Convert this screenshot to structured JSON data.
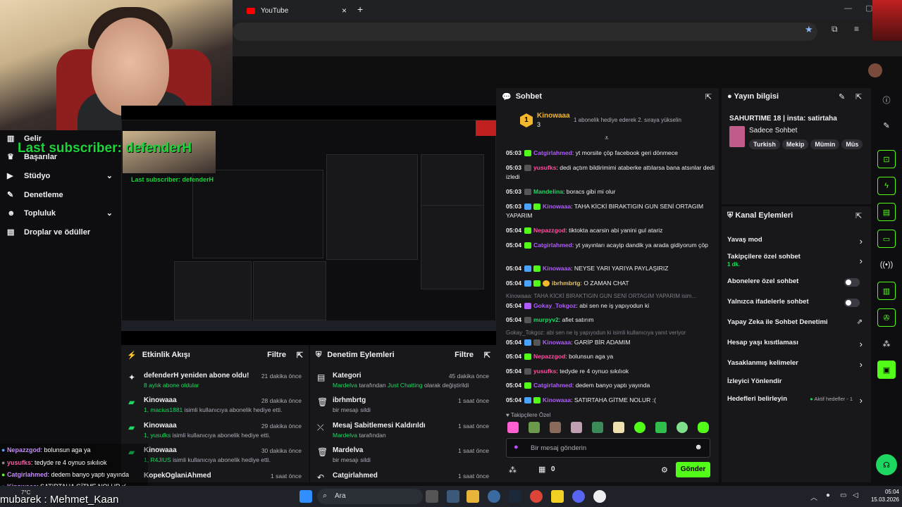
{
  "browser": {
    "tab_title": "YouTube",
    "new_tab": "+",
    "close_tab": "×"
  },
  "overlay": {
    "last_subscriber": "Last subscriber: defenderH",
    "mini_last_subscriber": "Last subscriber: defenderH",
    "mubarek": "mubarek : Mehmet_Kaan"
  },
  "leftnav": {
    "items": [
      {
        "label": "Gelir",
        "icon": "chart-icon"
      },
      {
        "label": "Başarılar",
        "icon": "trophy-icon"
      },
      {
        "label": "Stüdyo",
        "icon": "video-icon"
      },
      {
        "label": "Denetleme",
        "icon": "wrench-icon"
      },
      {
        "label": "Topluluk",
        "icon": "people-icon"
      },
      {
        "label": "Droplar ve ödüller",
        "icon": "gift-icon"
      }
    ]
  },
  "activity": {
    "title": "Etkinlik Akışı",
    "filter": "Filtre",
    "items": [
      {
        "title": "defenderH yeniden abone oldu!",
        "sub_hl": "8 aylık abone oldular",
        "sub": "",
        "time": "21 dakika önce"
      },
      {
        "title": "Kinowaaa",
        "sub_hl": "1, macius1881",
        "sub": " isimli kullanıcıya abonelik hediye etti.",
        "time": "28 dakika önce"
      },
      {
        "title": "Kinowaaa",
        "sub_hl": "1, yusufks",
        "sub": " isimli kullanıcıya abonelik hediye etti.",
        "time": "29 dakika önce"
      },
      {
        "title": "Kinowaaa",
        "sub_hl": "1, R4JIUS",
        "sub": " isimli kullanıcıya abonelik hediye etti.",
        "time": "30 dakika önce"
      },
      {
        "title": "KopekOglaniAhmed",
        "sub_hl": "",
        "sub": "",
        "time": "1 saat önce"
      }
    ]
  },
  "modactions": {
    "title": "Denetim Eylemleri",
    "filter": "Filtre",
    "items": [
      {
        "title": "Kategori",
        "sub_hl": "Mardelva",
        "sub": " tarafından ",
        "sub_hl2": "Just Chatting",
        "sub2": " olarak değiştirildi",
        "time": "45 dakika önce"
      },
      {
        "title": "ibrhmbrtg",
        "sub_hl": "",
        "sub": "bir mesajı sildi",
        "sub_hl2": "",
        "sub2": "",
        "time": "1 saat önce"
      },
      {
        "title": "Mesaj Sabitlemesi Kaldırıldı",
        "sub_hl": "Mardelva",
        "sub": " tarafından",
        "sub_hl2": "",
        "sub2": "",
        "time": "1 saat önce"
      },
      {
        "title": "Mardelva",
        "sub_hl": "",
        "sub": "bir mesajı sildi",
        "sub_hl2": "",
        "sub2": "",
        "time": "1 saat önce"
      },
      {
        "title": "Catgirlahmed",
        "sub_hl": "",
        "sub": "",
        "sub_hl2": "",
        "sub2": "",
        "time": "1 saat önce"
      }
    ]
  },
  "chat": {
    "title": "Sohbet",
    "pinned_user": "Kinowaaa",
    "pinned_count": "3",
    "pinned_rank": "1",
    "pinned_text": "1 abonelik hediye ederek 2. sıraya yükselin",
    "messages": [
      {
        "time": "05:03",
        "user": "Catgirlahmed",
        "color": "#b05bff",
        "text": "yt morsite çöp facebook geri dönmece"
      },
      {
        "time": "05:03",
        "user": "yusufks",
        "color": "#ff4fa0",
        "text": "dedi açtım bildirimimi ataberke attılarsa bana atsınlar dedi izledi"
      },
      {
        "time": "05:03",
        "user": "Mandelina",
        "color": "#1ed760",
        "text": "boracs gibi mi olur"
      },
      {
        "time": "05:03",
        "user": "Kinowaaa",
        "color": "#b05bff",
        "text": "TAHA KİCKİ BIRAKTIGIN GUN SENİ ORTAGIM YAPARIM"
      },
      {
        "time": "05:04",
        "user": "Nepazzgod",
        "color": "#ff4fa0",
        "text": "tiktokta acarsin abi yanini gul atariz"
      },
      {
        "time": "05:04",
        "user": "Catgirlahmed",
        "color": "#b05bff",
        "text": "yt yayınları acayip dandik ya arada gidiyorum çöp"
      },
      {
        "time": "05:04",
        "user": "Kinowaaa",
        "color": "#b05bff",
        "text": "NEYSE YARI YARIYA PAYLAŞIRIZ"
      },
      {
        "time": "05:04",
        "user": "ibrhmbrtg",
        "color": "#e0c36b",
        "text": "O ZAMAN CHAT"
      },
      {
        "time": "05:04",
        "user": "Gokay_Tokgoz",
        "color": "#b05bff",
        "text": "abi sen ne iş yapıyodun ki"
      },
      {
        "time": "05:04",
        "user": "murpyv2",
        "color": "#1ed760",
        "text": "afiet satırım"
      },
      {
        "time": "05:04",
        "user": "Kinowaaa",
        "color": "#b05bff",
        "text": "GARİP BİR ADAMIM"
      },
      {
        "time": "05:04",
        "user": "Nepazzgod",
        "color": "#ff4fa0",
        "text": "bolunsun aga ya"
      },
      {
        "time": "05:04",
        "user": "yusufks",
        "color": "#ff4fa0",
        "text": "tedyde re 4 oynuo sıkılıok"
      },
      {
        "time": "05:04",
        "user": "Catgirlahmed",
        "color": "#b05bff",
        "text": "dedem banyo yaptı yayında"
      },
      {
        "time": "05:04",
        "user": "Kinowaaa",
        "color": "#b05bff",
        "text": "SATIRTAHA GİTME NOLUR :("
      }
    ],
    "reply1": "Kinowaaa: TAHA KİCKİ BIRAKTIGIN GUN SENİ ORTAGIM YAPARIM isim...",
    "reply2": "Gokay_Tokgoz: abi sen ne iş yapıyodun ki isimli kullanıcıya yanıt veriyor",
    "emote_label": "Takipçilere Özel",
    "input_placeholder": "Bir mesaj gönderin",
    "points": "0",
    "send": "Gönder"
  },
  "stream_info": {
    "title": "Yayın bilgisi",
    "stream_title": "SAHURTIME 18 | insta: satirtaha",
    "category": "Sadece Sohbet",
    "tags": [
      "Turkish",
      "Mekip",
      "Mümin",
      "Müs"
    ]
  },
  "channel_actions": {
    "title": "Kanal Eylemleri",
    "rows": [
      {
        "label": "Yavaş mod",
        "extra": "",
        "control": "chevron"
      },
      {
        "label": "Takipçilere özel sohbet",
        "extra": "1 dk.",
        "control": "chevron"
      },
      {
        "label": "Abonelere özel sohbet",
        "extra": "",
        "control": "toggle"
      },
      {
        "label": "Yalnızca ifadelerle sohbet",
        "extra": "",
        "control": "toggle"
      },
      {
        "label": "Yapay Zeka ile Sohbet Denetimi",
        "extra": "",
        "control": "external"
      },
      {
        "label": "Hesap yaşı kısıtlaması",
        "extra": "",
        "control": "chevron"
      },
      {
        "label": "Yasaklanmış kelimeler",
        "extra": "",
        "control": "chevron"
      },
      {
        "label": "İzleyici Yönlendir",
        "extra": "",
        "control": "none"
      },
      {
        "label": "Hedefleri belirleyin",
        "extra": "Aktif hedefler - 1",
        "control": "chevron"
      }
    ]
  },
  "overlay_chat": [
    {
      "user": "Nepazzgod",
      "color": "#c98cff",
      "text": ": bolunsun aga ya"
    },
    {
      "user": "yusufks",
      "color": "#ff5fa8",
      "text": ": tedyde re 4 oynuo sıkılıok"
    },
    {
      "user": "Catgirlahmed",
      "color": "#c98cff",
      "text": ": dedem banyo yaptı yayında"
    },
    {
      "user": "Kinowaaa",
      "color": "#c98cff",
      "text": ": SATIRTAHA GİTME NOLUR :("
    }
  ],
  "taskbar": {
    "search": "Ara",
    "time": "05:04",
    "date": "15.03.2026",
    "weather": "7°C"
  },
  "colors": {
    "accent": "#53fc18",
    "bg": "#0e0e10",
    "panel": "#18181b"
  }
}
